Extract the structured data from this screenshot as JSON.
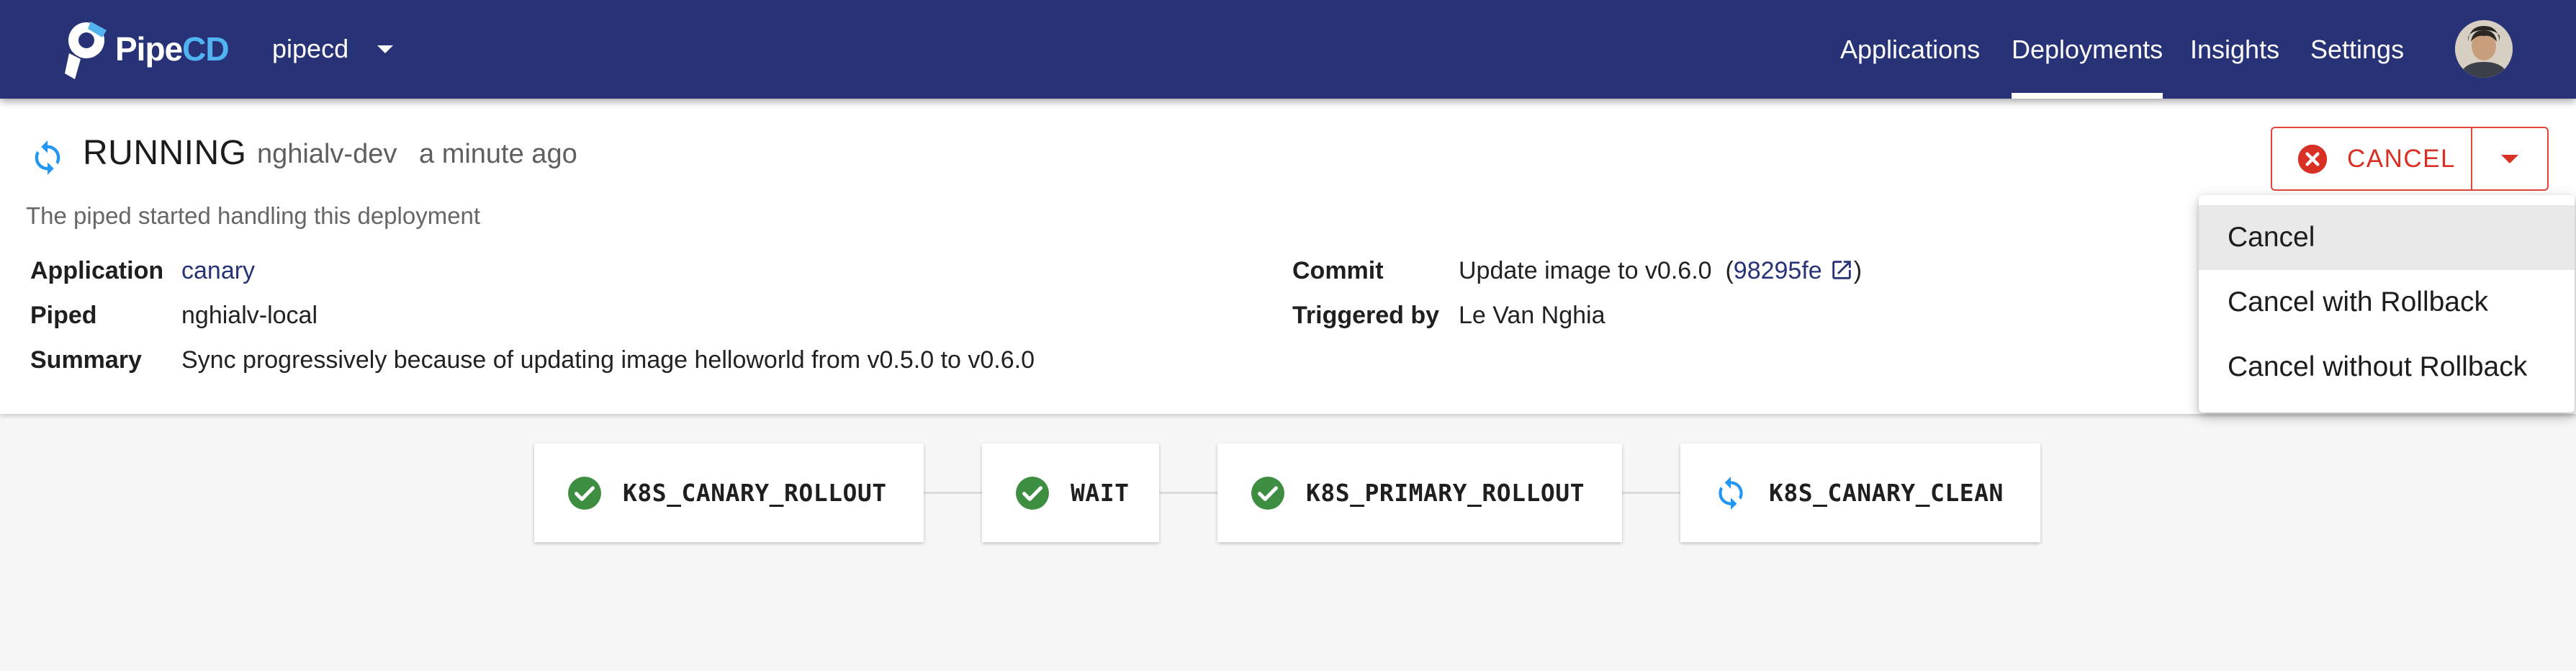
{
  "header": {
    "logo_main": "Pipe",
    "logo_accent": "CD",
    "project": "pipecd",
    "nav": [
      {
        "label": "Applications"
      },
      {
        "label": "Deployments",
        "active": true
      },
      {
        "label": "Insights"
      },
      {
        "label": "Settings"
      }
    ]
  },
  "deployment": {
    "status": "RUNNING",
    "env": "nghialv-dev",
    "time_ago": "a minute ago",
    "description": "The piped started handling this deployment",
    "fields": {
      "application_label": "Application",
      "application_value": "canary",
      "piped_label": "Piped",
      "piped_value": "nghialv-local",
      "summary_label": "Summary",
      "summary_value": "Sync progressively because of updating image helloworld from v0.5.0 to v0.6.0",
      "commit_label": "Commit",
      "commit_message": "Update image to v0.6.0",
      "commit_hash": "98295fe",
      "triggered_label": "Triggered by",
      "triggered_value": "Le Van Nghia"
    }
  },
  "cancel_button": {
    "label": "CANCEL",
    "menu": [
      "Cancel",
      "Cancel with Rollback",
      "Cancel without Rollback"
    ]
  },
  "pipeline": {
    "stages": [
      {
        "name": "K8S_CANARY_ROLLOUT",
        "status": "success"
      },
      {
        "name": "WAIT",
        "status": "success"
      },
      {
        "name": "K8S_PRIMARY_ROLLOUT",
        "status": "success"
      },
      {
        "name": "K8S_CANARY_CLEAN",
        "status": "running"
      }
    ]
  },
  "colors": {
    "appbar": "#283276",
    "accent_blue": "#51b3f0",
    "running_blue": "#2196f3",
    "success_green": "#3e8e41",
    "cancel_red": "#d93025"
  },
  "icons": {
    "running": "sync-icon",
    "success": "check-circle-icon",
    "cancel": "cancel-circle-icon",
    "external": "open-in-new-icon"
  }
}
